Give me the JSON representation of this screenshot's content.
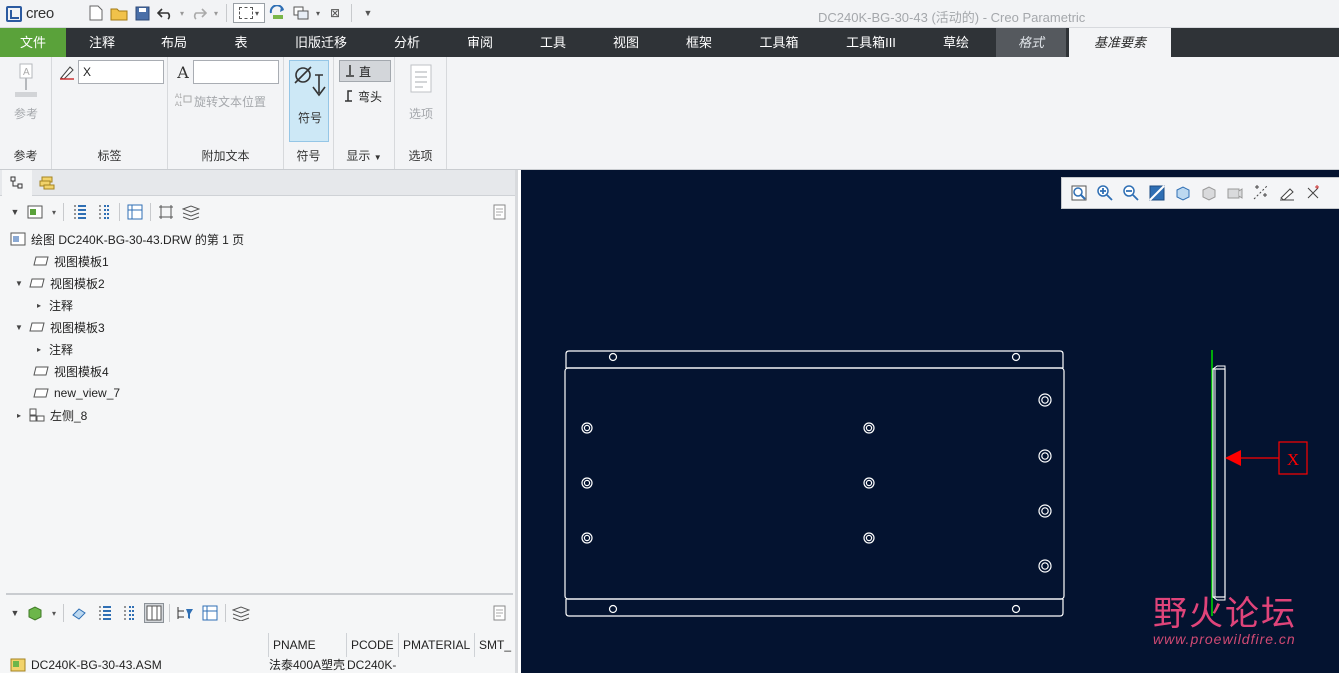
{
  "app": {
    "logo_text": "creo",
    "window_title": "DC240K-BG-30-43 (活动的) - Creo Parametric"
  },
  "tabs": [
    {
      "label": "文件"
    },
    {
      "label": "注释"
    },
    {
      "label": "布局"
    },
    {
      "label": "表"
    },
    {
      "label": "旧版迁移"
    },
    {
      "label": "分析"
    },
    {
      "label": "审阅"
    },
    {
      "label": "工具"
    },
    {
      "label": "视图"
    },
    {
      "label": "框架"
    },
    {
      "label": "工具箱"
    },
    {
      "label": "工具箱III"
    },
    {
      "label": "草绘"
    },
    {
      "label": "格式"
    },
    {
      "label": "基准要素"
    }
  ],
  "ribbon": {
    "reference": {
      "button_label": "参考",
      "group_label": "参考"
    },
    "label": {
      "input_value": "X",
      "group_label": "标签"
    },
    "attached_text": {
      "input_value": "",
      "rotate_label": "旋转文本位置",
      "group_label": "附加文本"
    },
    "symbol": {
      "button_label": "符号",
      "group_label": "符号"
    },
    "display": {
      "straight_label": "直",
      "elbow_label": "弯头",
      "group_label": "显示"
    },
    "options": {
      "button_label": "选项",
      "group_label": "选项"
    }
  },
  "model_tree": {
    "root": "绘图 DC240K-BG-30-43.DRW 的第 1 页",
    "items": [
      {
        "label": "视图模板1"
      },
      {
        "label": "视图模板2"
      },
      {
        "label": "注释"
      },
      {
        "label": "视图模板3"
      },
      {
        "label": "注释"
      },
      {
        "label": "视图模板4"
      },
      {
        "label": "new_view_7"
      },
      {
        "label": "左侧_8"
      }
    ]
  },
  "table": {
    "columns": [
      "PNAME",
      "PCODE",
      "PMATERIAL",
      "SMT_"
    ],
    "row": {
      "name": "DC240K-BG-30-43.ASM",
      "pname": "法泰400A塑壳",
      "pcode": "DC240K-"
    }
  },
  "drawing": {
    "datum_label": "X",
    "line_color": "#ffffff",
    "datum_color": "#ff0000",
    "axis_color": "#00d000"
  },
  "watermark": {
    "title": "野火论坛",
    "url": "www.proewildfire.cn"
  },
  "colors": {
    "file_tab": "#5aa23a",
    "tabbar": "#2f3337",
    "canvas": "#041330",
    "ribbon": "#f3f4f6"
  }
}
